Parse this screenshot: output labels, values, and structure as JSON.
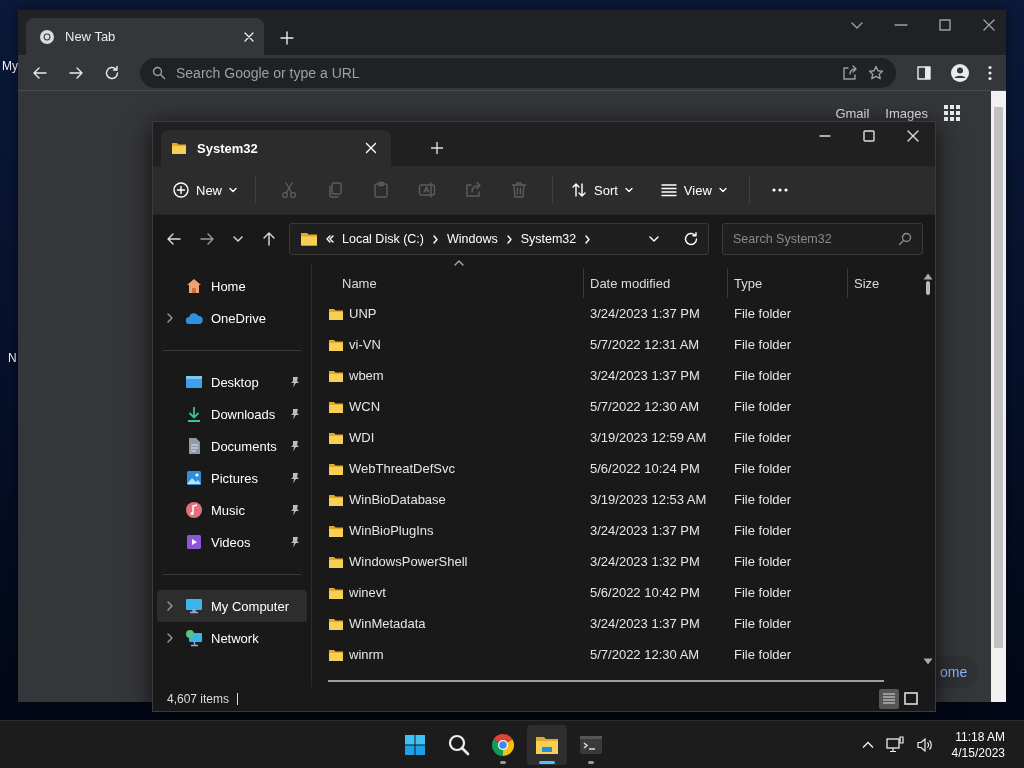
{
  "desktop_icons": [
    {
      "label": "My"
    },
    {
      "label": "N"
    }
  ],
  "browser": {
    "tab": {
      "title": "New Tab",
      "selected": true
    },
    "address_bar": {
      "placeholder": "Search Google or type a URL"
    },
    "links": [
      "Gmail",
      "Images"
    ],
    "shortcut_button": {
      "label": "ome"
    }
  },
  "explorer": {
    "tab": {
      "title": "System32",
      "selected": true
    },
    "toolbar": {
      "new_button": "New",
      "actions": [
        {
          "disabled": true
        },
        {
          "disabled": true
        },
        {
          "disabled": true
        },
        {
          "disabled": true
        },
        {
          "disabled": true
        },
        {
          "disabled": true
        }
      ],
      "sort_button": "Sort",
      "view_button": "View"
    },
    "breadcrumb": [
      "Local Disk (C:)",
      "Windows",
      "System32"
    ],
    "search": {
      "placeholder": "Search System32"
    },
    "sidebar": {
      "groups": [
        [
          {
            "label": "Home",
            "expandable": false,
            "pinned": false,
            "selected": false
          },
          {
            "label": "OneDrive",
            "expandable": true,
            "pinned": false,
            "selected": false
          }
        ],
        [
          {
            "label": "Desktop",
            "expandable": false,
            "pinned": true,
            "selected": false
          },
          {
            "label": "Downloads",
            "expandable": false,
            "pinned": true,
            "selected": false
          },
          {
            "label": "Documents",
            "expandable": false,
            "pinned": true,
            "selected": false
          },
          {
            "label": "Pictures",
            "expandable": false,
            "pinned": true,
            "selected": false
          },
          {
            "label": "Music",
            "expandable": false,
            "pinned": true,
            "selected": false
          },
          {
            "label": "Videos",
            "expandable": false,
            "pinned": true,
            "selected": false
          }
        ],
        [
          {
            "label": "My Computer",
            "expandable": true,
            "pinned": false,
            "selected": true
          },
          {
            "label": "Network",
            "expandable": true,
            "pinned": false,
            "selected": false
          }
        ]
      ]
    },
    "columns": [
      {
        "label": "Name",
        "sorted": true
      },
      {
        "label": "Date modified",
        "sorted": false
      },
      {
        "label": "Type",
        "sorted": false
      },
      {
        "label": "Size",
        "sorted": false
      }
    ],
    "rows": [
      {
        "name": "UNP",
        "date_modified": "3/24/2023 1:37 PM",
        "type": "File folder"
      },
      {
        "name": "vi-VN",
        "date_modified": "5/7/2022 12:31 AM",
        "type": "File folder"
      },
      {
        "name": "wbem",
        "date_modified": "3/24/2023 1:37 PM",
        "type": "File folder"
      },
      {
        "name": "WCN",
        "date_modified": "5/7/2022 12:30 AM",
        "type": "File folder"
      },
      {
        "name": "WDI",
        "date_modified": "3/19/2023 12:59 AM",
        "type": "File folder"
      },
      {
        "name": "WebThreatDefSvc",
        "date_modified": "5/6/2022 10:24 PM",
        "type": "File folder"
      },
      {
        "name": "WinBioDatabase",
        "date_modified": "3/19/2023 12:53 AM",
        "type": "File folder"
      },
      {
        "name": "WinBioPlugIns",
        "date_modified": "3/24/2023 1:37 PM",
        "type": "File folder"
      },
      {
        "name": "WindowsPowerShell",
        "date_modified": "3/24/2023 1:32 PM",
        "type": "File folder"
      },
      {
        "name": "winevt",
        "date_modified": "5/6/2022 10:42 PM",
        "type": "File folder"
      },
      {
        "name": "WinMetadata",
        "date_modified": "3/24/2023 1:37 PM",
        "type": "File folder"
      },
      {
        "name": "winrm",
        "date_modified": "5/7/2022 12:30 AM",
        "type": "File folder"
      }
    ],
    "status_bar": {
      "item_count": "4,607 items"
    },
    "view_modes": [
      {
        "selected": true
      },
      {
        "selected": false
      }
    ]
  },
  "taskbar": {
    "apps": [
      {
        "selected": false,
        "running": false
      },
      {
        "selected": false,
        "running": false
      },
      {
        "selected": false,
        "running": true
      },
      {
        "selected": true,
        "running": true
      },
      {
        "selected": false,
        "running": true
      }
    ],
    "clock": {
      "time": "11:18 AM",
      "date": "4/15/2023"
    }
  }
}
